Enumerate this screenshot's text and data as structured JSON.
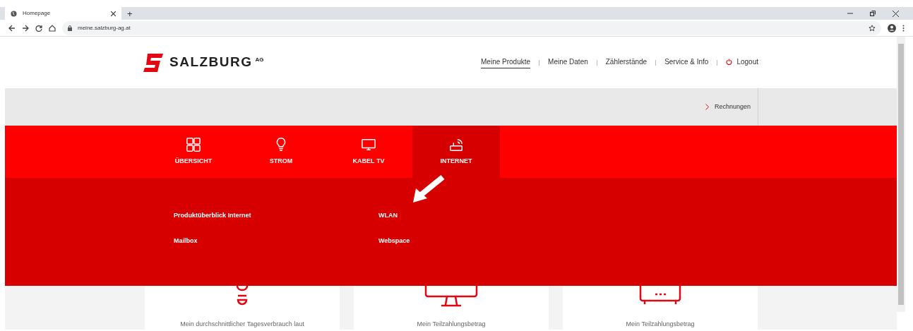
{
  "browser": {
    "tab_title": "Homepage",
    "new_tab": "+",
    "url": "meine.salzburg-ag.at"
  },
  "header": {
    "logo_text": "SALZBURG",
    "logo_suffix": "AG",
    "nav": [
      {
        "label": "Meine Produkte",
        "selected": true,
        "kind": "link"
      },
      {
        "label": "Meine Daten",
        "selected": false,
        "kind": "link"
      },
      {
        "label": "Zählerstände",
        "selected": false,
        "kind": "link"
      },
      {
        "label": "Service & Info",
        "selected": false,
        "kind": "link"
      },
      {
        "label": "Logout",
        "selected": false,
        "kind": "logout"
      }
    ]
  },
  "subbar": {
    "link": "Rechnungen"
  },
  "product_tabs": [
    {
      "label": "ÜBERSICHT",
      "kind": "grid",
      "selected": false
    },
    {
      "label": "STROM",
      "kind": "bulb",
      "selected": false
    },
    {
      "label": "KABEL TV",
      "kind": "tv",
      "selected": false
    },
    {
      "label": "INTERNET",
      "kind": "router",
      "selected": true
    }
  ],
  "dropdown": {
    "columns": [
      [
        "Produktüberblick Internet",
        "Mailbox"
      ],
      [
        "WLAN",
        "Webspace"
      ]
    ]
  },
  "cards": [
    {
      "kind": "bulb",
      "text": "Mein durchschnittlicher Tagesverbrauch laut"
    },
    {
      "kind": "tv",
      "text": "Mein Teilzahlungsbetrag"
    },
    {
      "kind": "router",
      "text": "Mein Teilzahlungsbetrag"
    }
  ]
}
